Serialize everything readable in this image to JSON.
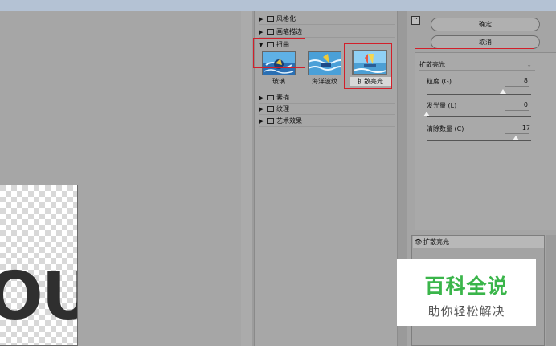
{
  "gallery": {
    "folders_top": [
      {
        "label": "风格化",
        "state": "collapsed"
      },
      {
        "label": "画笔描边",
        "state": "collapsed"
      },
      {
        "label": "扭曲",
        "state": "expanded"
      }
    ],
    "thumbnails": [
      {
        "label": "玻璃"
      },
      {
        "label": "海洋波纹"
      },
      {
        "label": "扩散亮光",
        "selected": true
      }
    ],
    "folders_bottom": [
      {
        "label": "素描",
        "state": "collapsed"
      },
      {
        "label": "纹理",
        "state": "collapsed"
      },
      {
        "label": "艺术效果",
        "state": "collapsed"
      }
    ]
  },
  "buttons": {
    "ok": "确定",
    "cancel": "取消"
  },
  "filter_select": {
    "value": "扩散亮光"
  },
  "params": [
    {
      "label": "粒度 (G)",
      "value": "8",
      "slider_fraction": 0.73
    },
    {
      "label": "发光量 (L)",
      "value": "0",
      "slider_fraction": 0.0
    },
    {
      "label": "清除数量 (C)",
      "value": "17",
      "slider_fraction": 0.85
    }
  ],
  "layers": {
    "items": [
      {
        "label": "扩散亮光",
        "visible": true
      }
    ]
  },
  "preview": {
    "canvas_text": "OU"
  },
  "watermark": {
    "title": "百科全说",
    "subtitle": "助你轻松解决"
  },
  "colors": {
    "highlight_red": "#d21f2a",
    "watermark_green": "#3ab54a"
  }
}
